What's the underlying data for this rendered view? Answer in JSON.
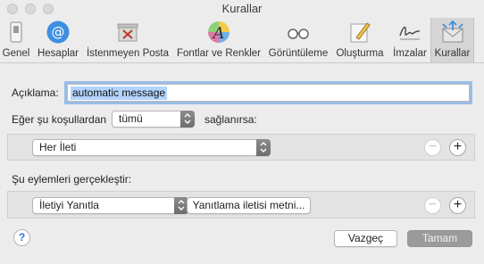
{
  "window": {
    "title": "Kurallar"
  },
  "toolbar": {
    "tabs": [
      {
        "label": "Genel",
        "icon": "switch-icon",
        "active": false
      },
      {
        "label": "Hesaplar",
        "icon": "at-sign-icon",
        "active": false
      },
      {
        "label": "İstenmeyen Posta",
        "icon": "junk-mail-icon",
        "active": false
      },
      {
        "label": "Fontlar ve Renkler",
        "icon": "font-color-icon",
        "active": false
      },
      {
        "label": "Görüntüleme",
        "icon": "glasses-icon",
        "active": false
      },
      {
        "label": "Oluşturma",
        "icon": "compose-pencil-icon",
        "active": false
      },
      {
        "label": "İmzalar",
        "icon": "signature-icon",
        "active": false
      },
      {
        "label": "Kurallar",
        "icon": "rules-envelope-icon",
        "active": true
      }
    ]
  },
  "form": {
    "description_label": "Açıklama:",
    "description_value": "automatic message",
    "condition_prefix": "Eğer şu koşullardan",
    "condition_select": "tümü",
    "condition_suffix": "sağlanırsa:",
    "condition_row_select": "Her İleti",
    "actions_label": "Şu eylemleri gerçekleştir:",
    "action_row_select": "İletiyi Yanıtla",
    "action_row_button": "Yanıtlama iletisi metni..."
  },
  "buttons": {
    "remove": "−",
    "add": "+",
    "help": "?",
    "cancel": "Vazgeç",
    "ok": "Tamam"
  }
}
